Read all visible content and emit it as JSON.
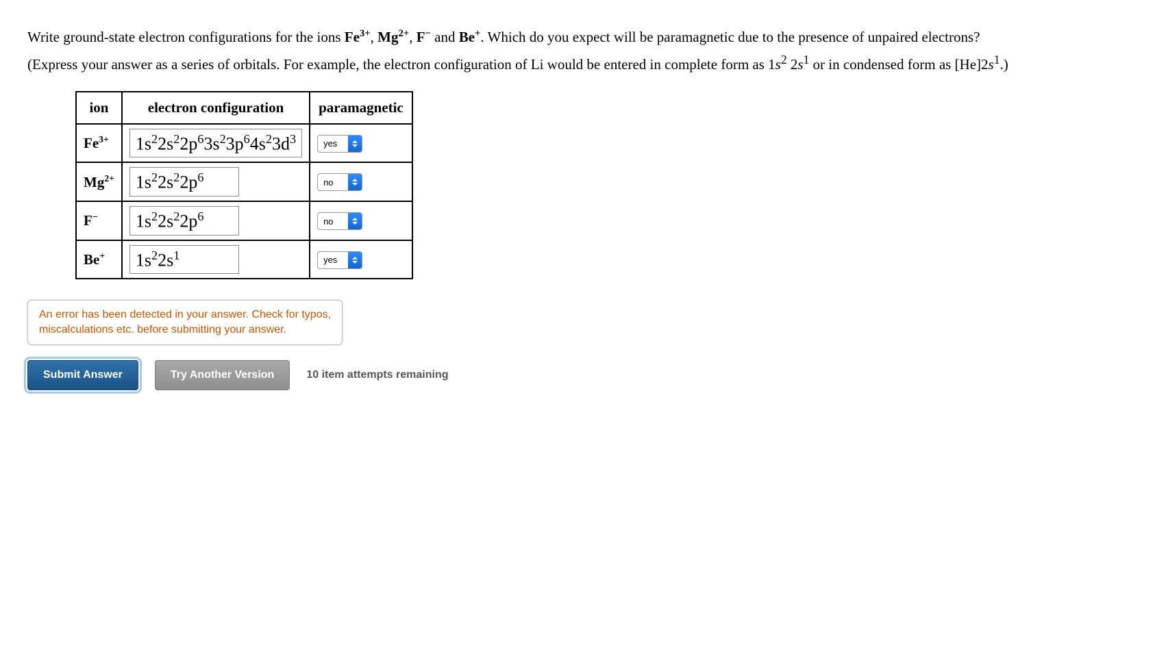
{
  "question": {
    "line1_preIons": "Write ground-state electron configurations for the ions ",
    "ions": [
      {
        "symbol": "Fe",
        "charge": "3+"
      },
      {
        "symbol": "Mg",
        "charge": "2+"
      },
      {
        "symbol": "F",
        "charge": "−"
      },
      {
        "symbol": "Be",
        "charge": "+"
      }
    ],
    "line1_post": ". Which do you expect will be paramagnetic due to the presence of unpaired electrons?",
    "line2_pre": "(Express your answer as a series of orbitals. For example, the electron configuration of Li would be entered in complete form as 1",
    "li_full_orbitals": [
      {
        "shell": "s",
        "exp": "2"
      },
      {
        "pre": " 2",
        "shell": "s",
        "exp": "1"
      }
    ],
    "line2_mid": " or in condensed form as [He]2",
    "li_cond_shell": "s",
    "li_cond_exp": "1",
    "line2_post": ".)"
  },
  "table": {
    "headers": {
      "ion": "ion",
      "config": "electron configuration",
      "param": "paramagnetic"
    },
    "rows": [
      {
        "ion_symbol": "Fe",
        "ion_charge": "3+",
        "config_html_parts": [
          {
            "t": "1s",
            "e": "2"
          },
          {
            "t": "2s",
            "e": "2"
          },
          {
            "t": "2p",
            "e": "6"
          },
          {
            "t": "3s",
            "e": "2"
          },
          {
            "t": "3p",
            "e": "6"
          },
          {
            "t": "4s",
            "e": "2"
          },
          {
            "t": "3d",
            "e": "3"
          }
        ],
        "param_value": "yes"
      },
      {
        "ion_symbol": "Mg",
        "ion_charge": "2+",
        "config_html_parts": [
          {
            "t": "1s",
            "e": "2"
          },
          {
            "t": "2s",
            "e": "2"
          },
          {
            "t": "2p",
            "e": "6"
          }
        ],
        "param_value": "no"
      },
      {
        "ion_symbol": "F",
        "ion_charge": "−",
        "config_html_parts": [
          {
            "t": "1s",
            "e": "2"
          },
          {
            "t": "2s",
            "e": "2"
          },
          {
            "t": "2p",
            "e": "6"
          }
        ],
        "param_value": "no"
      },
      {
        "ion_symbol": "Be",
        "ion_charge": "+",
        "config_html_parts": [
          {
            "t": "1s",
            "e": "2"
          },
          {
            "t": "2s",
            "e": "1"
          }
        ],
        "param_value": "yes"
      }
    ]
  },
  "error": {
    "line1": "An error has been detected in your answer. Check for typos,",
    "line2": "miscalculations etc. before submitting your answer."
  },
  "buttons": {
    "submit": "Submit Answer",
    "try_another": "Try Another Version"
  },
  "attempts": "10 item attempts remaining"
}
